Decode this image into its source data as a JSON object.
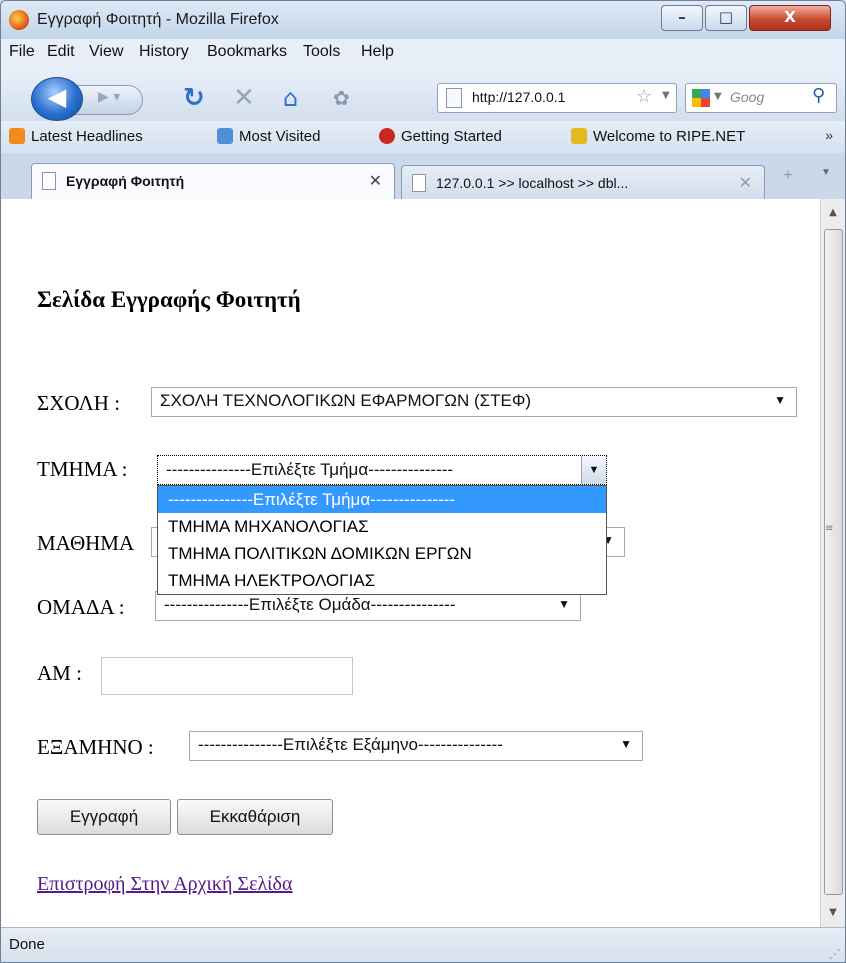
{
  "window": {
    "title": "Εγγραφή Φοιτητή - Mozilla Firefox",
    "minimize": "–",
    "maximize": "□",
    "close": "X"
  },
  "menu": {
    "items": [
      "File",
      "Edit",
      "View",
      "History",
      "Bookmarks",
      "Tools",
      "Help"
    ]
  },
  "nav": {
    "url": "http://127.0.0.1",
    "search_placeholder": "Goog"
  },
  "bookmarks": {
    "items": [
      "Latest Headlines",
      "Most Visited",
      "Getting Started",
      "Welcome to RIPE.NET"
    ],
    "more": "»"
  },
  "tabs": [
    {
      "label": "Εγγραφή Φοιτητή",
      "active": true
    },
    {
      "label": "127.0.0.1 >> localhost >> dbl...",
      "active": false
    }
  ],
  "page": {
    "heading": "Σελίδα Εγγραφής Φοιτητή",
    "school": {
      "label": "ΣΧΟΛΗ :",
      "value": "ΣΧΟΛΗ ΤΕΧΝΟΛΟΓΙΚΩΝ ΕΦΑΡΜΟΓΩΝ (ΣΤΕΦ)"
    },
    "department": {
      "label": "ΤΜΗΜΑ :",
      "value": "---------------Επιλέξτε Τμήμα---------------",
      "options": [
        "---------------Επιλέξτε Τμήμα---------------",
        "ΤΜΗΜΑ ΜΗΧΑΝΟΛΟΓΙΑΣ",
        "ΤΜΗΜΑ ΠΟΛΙΤΙΚΩΝ ΔΟΜΙΚΩΝ ΕΡΓΩΝ",
        "ΤΜΗΜΑ ΗΛΕΚΤΡΟΛΟΓΙΑΣ"
      ]
    },
    "course": {
      "label": "ΜΑΘΗΜΑ"
    },
    "group": {
      "label": "ΟΜΑΔΑ :",
      "value": "---------------Επιλέξτε Ομάδα---------------"
    },
    "am": {
      "label": "AM :",
      "value": ""
    },
    "semester": {
      "label": "ΕΞΑΜΗΝΟ :",
      "value": "---------------Επιλέξτε Εξάμηνο---------------"
    },
    "register_button": "Εγγραφή",
    "clear_button": "Εκκαθάριση",
    "back_link": "Επιστροφή Στην Αρχική Σελίδα"
  },
  "status": {
    "text": "Done"
  }
}
